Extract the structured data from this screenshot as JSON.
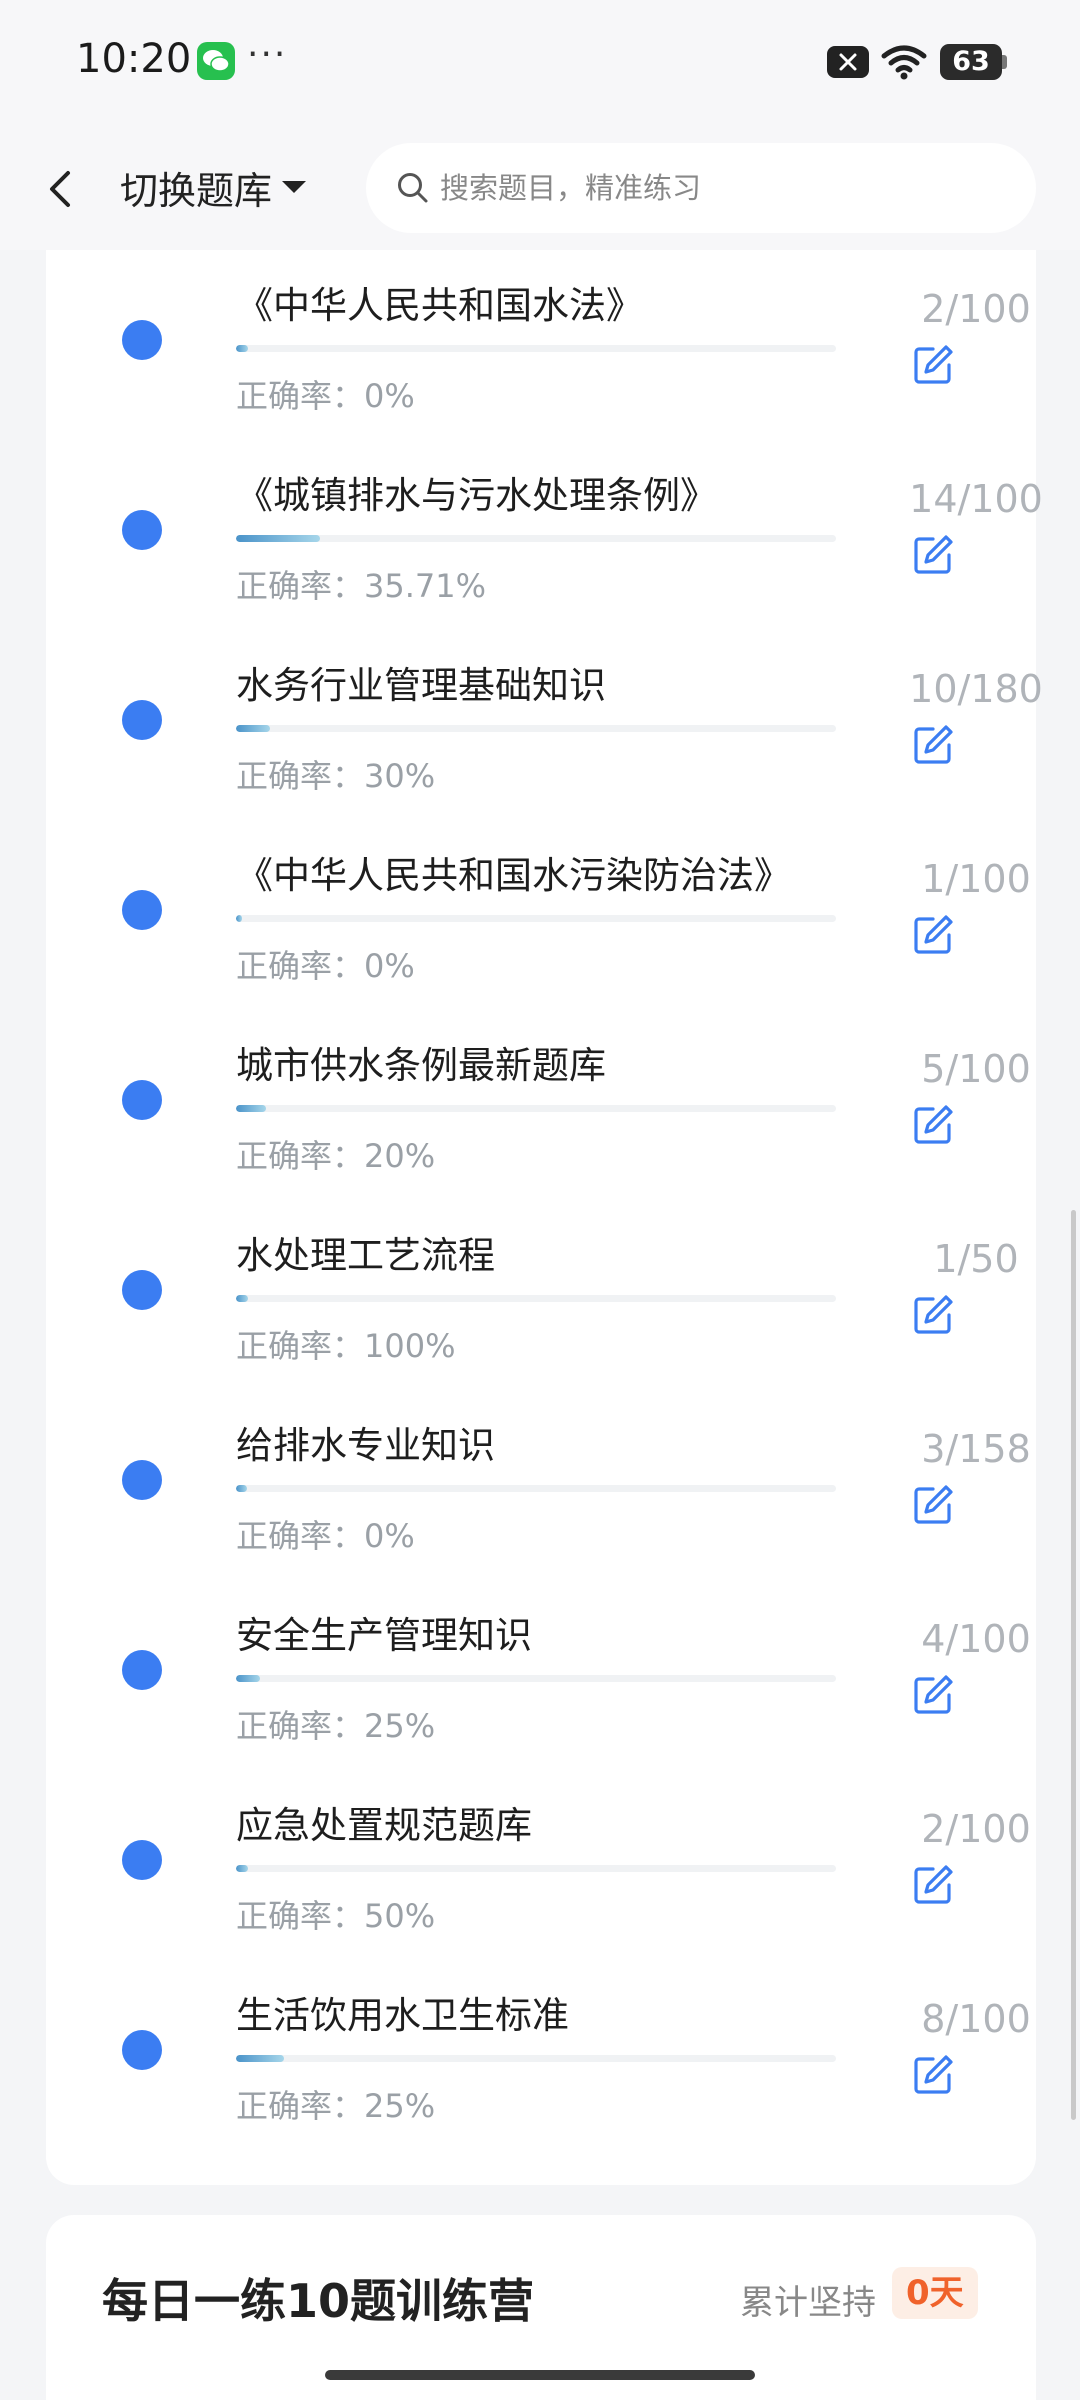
{
  "status_bar": {
    "time": "10:20",
    "more": "···",
    "battery": "63"
  },
  "header": {
    "switch_bank_label": "切换题库",
    "search_placeholder": "搜索题目，精准练习"
  },
  "colors": {
    "accent_blue": "#3b7df2",
    "progress": "#4a93c9",
    "badge_text": "#f0622b",
    "badge_bg": "#fdeee5"
  },
  "question_banks": [
    {
      "title": "《中华人民共和国水法》",
      "rate_label": "正确率：",
      "rate": "0%",
      "count": "2/100",
      "progress": 0.02
    },
    {
      "title": "《城镇排水与污水处理条例》",
      "rate_label": "正确率：",
      "rate": "35.71%",
      "count": "14/100",
      "progress": 0.14
    },
    {
      "title": "水务行业管理基础知识",
      "rate_label": "正确率：",
      "rate": "30%",
      "count": "10/180",
      "progress": 0.056
    },
    {
      "title": "《中华人民共和国水污染防治法》",
      "rate_label": "正确率：",
      "rate": "0%",
      "count": "1/100",
      "progress": 0.01
    },
    {
      "title": "城市供水条例最新题库",
      "rate_label": "正确率：",
      "rate": "20%",
      "count": "5/100",
      "progress": 0.05
    },
    {
      "title": "水处理工艺流程",
      "rate_label": "正确率：",
      "rate": "100%",
      "count": "1/50",
      "progress": 0.02
    },
    {
      "title": "给排水专业知识",
      "rate_label": "正确率：",
      "rate": "0%",
      "count": "3/158",
      "progress": 0.019
    },
    {
      "title": "安全生产管理知识",
      "rate_label": "正确率：",
      "rate": "25%",
      "count": "4/100",
      "progress": 0.04
    },
    {
      "title": "应急处置规范题库",
      "rate_label": "正确率：",
      "rate": "50%",
      "count": "2/100",
      "progress": 0.02
    },
    {
      "title": "生活饮用水卫生标准",
      "rate_label": "正确率：",
      "rate": "25%",
      "count": "8/100",
      "progress": 0.08
    }
  ],
  "training_camp": {
    "title": "每日一练10题训练营",
    "streak_label": "累计坚持",
    "streak_days": "0天"
  }
}
